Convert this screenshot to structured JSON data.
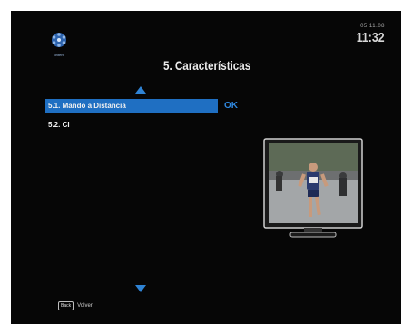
{
  "brand": {
    "logo_icon": "snowflake-logo-icon",
    "logo_text": "ontent"
  },
  "clock": {
    "date": "05.11.08",
    "time": "11:32"
  },
  "header": {
    "title": "5. Características"
  },
  "menu": {
    "items": [
      {
        "label": "5.1. Mando a Distancia",
        "selected": true
      },
      {
        "label": "5.2. CI",
        "selected": false
      }
    ],
    "ok_label": "OK"
  },
  "navigation": {
    "up_icon": "arrow-up-icon",
    "down_icon": "arrow-down-icon"
  },
  "preview": {
    "icon": "tv-preview-icon",
    "subject": "runner on city street"
  },
  "footer": {
    "back_key": "Back",
    "back_label": "Volver"
  },
  "colors": {
    "accent": "#1f6fc2",
    "ok": "#2f88e0",
    "background": "#060606"
  }
}
